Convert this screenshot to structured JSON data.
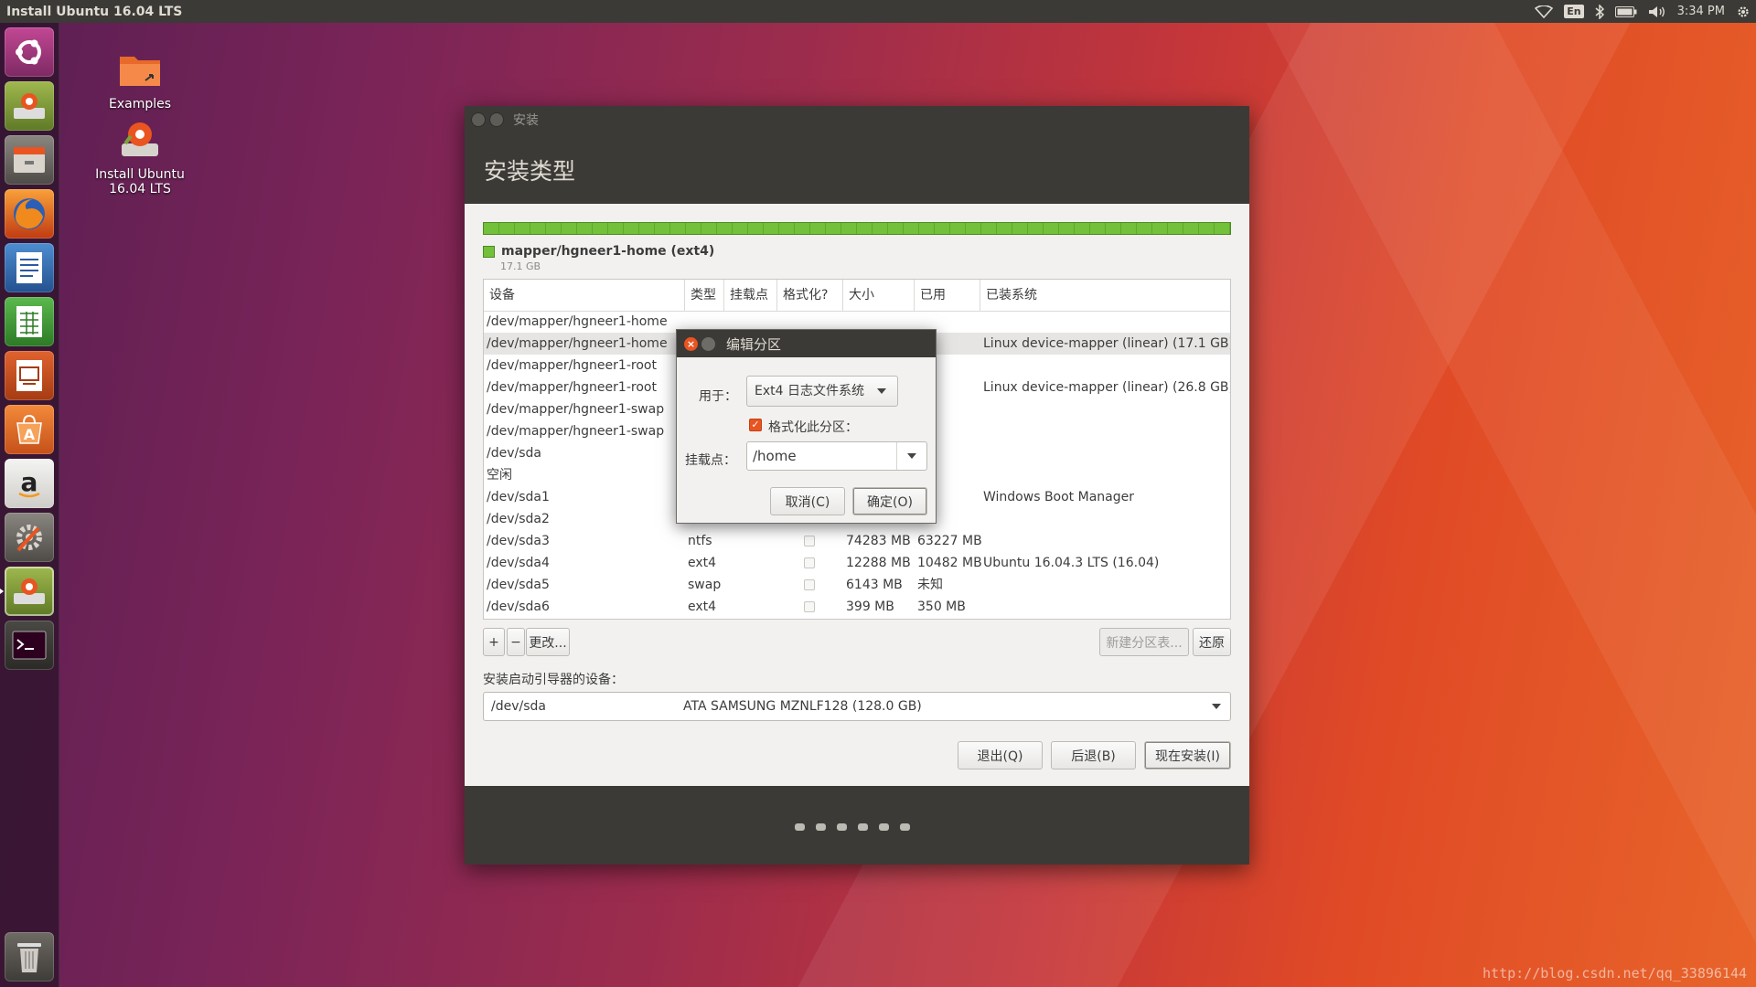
{
  "top_panel": {
    "title": "Install Ubuntu 16.04 LTS",
    "keyboard": "En",
    "clock": "3:34 PM"
  },
  "launcher": {
    "items": [
      "ubuntu-dash-icon",
      "installer-icon",
      "file-manager-icon",
      "firefox-icon",
      "writer-icon",
      "calc-icon",
      "impress-icon",
      "software-center-icon",
      "amazon-icon",
      "system-settings-icon",
      "installer-running-icon",
      "terminal-icon",
      "trash-icon"
    ]
  },
  "desktop": {
    "examples_label": "Examples",
    "installer_label_line1": "Install Ubuntu",
    "installer_label_line2": "16.04 LTS"
  },
  "window": {
    "title": "安装",
    "heading": "安装类型",
    "partition": {
      "name": "mapper/hgneer1-home (ext4)",
      "size": "17.1 GB"
    },
    "table": {
      "headers": [
        "设备",
        "类型",
        "挂载点",
        "格式化?",
        "大小",
        "已用",
        "已装系统"
      ],
      "rows": [
        {
          "device": "/dev/mapper/hgneer1-home",
          "type": "",
          "mount": "",
          "size": "",
          "used": "",
          "system": ""
        },
        {
          "device": " /dev/mapper/hgneer1-home",
          "type": "",
          "mount": "",
          "size": "",
          "used": "知",
          "system": "Linux device-mapper (linear) (17.1 GB)"
        },
        {
          "device": "/dev/mapper/hgneer1-root",
          "type": "",
          "mount": "",
          "size": "",
          "used": "",
          "system": ""
        },
        {
          "device": " /dev/mapper/hgneer1-root",
          "type": "",
          "mount": "",
          "size": "",
          "used": "知",
          "system": "Linux device-mapper (linear) (26.8 GB)"
        },
        {
          "device": "/dev/mapper/hgneer1-swap",
          "type": "",
          "mount": "",
          "size": "",
          "used": "",
          "system": ""
        },
        {
          "device": " /dev/mapper/hgneer1-swap",
          "type": "",
          "mount": "",
          "size": "",
          "used": "知",
          "system": ""
        },
        {
          "device": "/dev/sda",
          "type": "",
          "mount": "",
          "size": "",
          "used": "",
          "system": ""
        },
        {
          "device": " 空闲",
          "type": "",
          "mount": "",
          "size": "",
          "used": "",
          "system": ""
        },
        {
          "device": " /dev/sda1",
          "type": "",
          "mount": "",
          "size": "",
          "used": "MB",
          "system": "Windows Boot Manager"
        },
        {
          "device": " /dev/sda2",
          "type": "",
          "mount": "",
          "size": "",
          "used": "知",
          "system": ""
        },
        {
          "device": " /dev/sda3",
          "type": "ntfs",
          "mount": "",
          "size": "74283 MB",
          "used": "63227 MB",
          "system": ""
        },
        {
          "device": " /dev/sda4",
          "type": "ext4",
          "mount": "",
          "size": "12288 MB",
          "used": "10482 MB",
          "system": "Ubuntu 16.04.3 LTS (16.04)"
        },
        {
          "device": " /dev/sda5",
          "type": "swap",
          "mount": "",
          "size": "6143 MB",
          "used": "未知",
          "system": ""
        },
        {
          "device": " /dev/sda6",
          "type": "ext4",
          "mount": "",
          "size": "399 MB",
          "used": "350 MB",
          "system": ""
        }
      ]
    },
    "toolbar": {
      "add": "+",
      "remove": "−",
      "change": "更改...",
      "new_table": "新建分区表...",
      "revert": "还原"
    },
    "boot_loader_label": "安装启动引导器的设备：",
    "boot_device": "/dev/sda",
    "boot_device_desc": "ATA SAMSUNG MZNLF128 (128.0 GB)",
    "buttons": {
      "quit": "退出(Q)",
      "back": "后退(B)",
      "install": "现在安装(I)"
    }
  },
  "dialog": {
    "title": "编辑分区",
    "use_as_label": "用于：",
    "use_as_value": "Ext4 日志文件系统",
    "format_label": "格式化此分区：",
    "format_checked": true,
    "mount_label": "挂载点：",
    "mount_value": "/home",
    "cancel": "取消(C)",
    "ok": "确定(O)"
  },
  "watermark": "http://blog.csdn.net/qq_33896144"
}
